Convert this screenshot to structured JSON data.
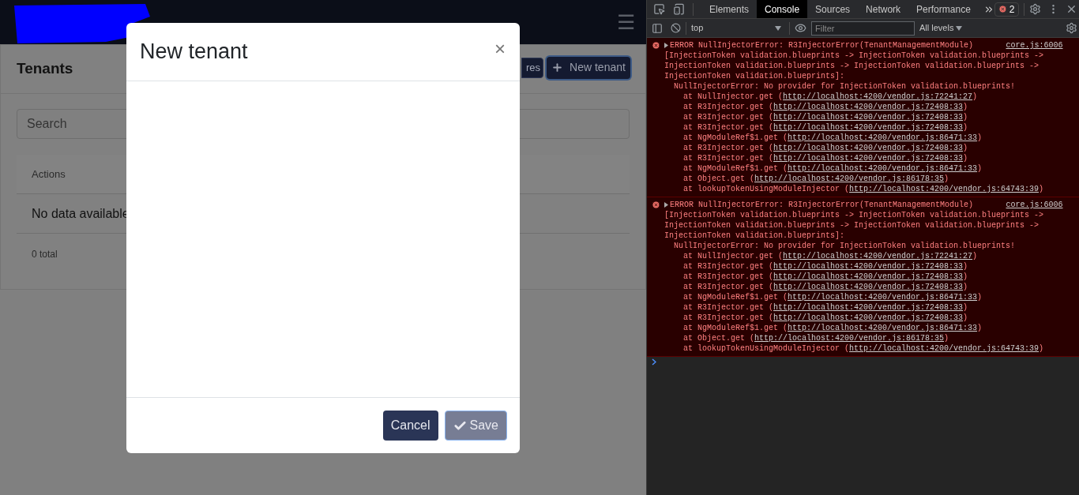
{
  "app": {
    "menu_button": "☰",
    "page_title": "Tenants",
    "header_buttons": [
      {
        "kind": "partial",
        "label": "res"
      },
      {
        "kind": "primary",
        "label": "New tenant",
        "focused": true
      }
    ],
    "search": {
      "placeholder": "Search"
    },
    "table": {
      "columns": [
        "Actions"
      ],
      "empty_text": "No data available",
      "total": "0 total"
    }
  },
  "modal": {
    "title": "New tenant",
    "close": "×",
    "buttons": [
      {
        "kind": "cancel",
        "label": "Cancel",
        "disabled": false
      },
      {
        "kind": "save",
        "label": "Save",
        "disabled": true
      }
    ]
  },
  "devtools": {
    "tabs": [
      {
        "label": "Elements",
        "selected": false
      },
      {
        "label": "Console",
        "selected": true
      },
      {
        "label": "Sources",
        "selected": false
      },
      {
        "label": "Network",
        "selected": false
      },
      {
        "label": "Performance",
        "selected": false
      }
    ],
    "error_count": "2",
    "context": "top",
    "filter": {
      "placeholder": "Filter"
    },
    "levels": "All levels",
    "messages": [
      {
        "source": "core.js:6006",
        "header": "ERROR NullInjectorError: R3InjectorError(TenantManagementModule)",
        "lines": [
          "[InjectionToken validation.blueprints -> InjectionToken validation.blueprints ->",
          "InjectionToken validation.blueprints -> InjectionToken validation.blueprints ->",
          "InjectionToken validation.blueprints]:"
        ],
        "detail": "NullInjectorError: No provider for InjectionToken validation.blueprints!",
        "stack": [
          {
            "text": "at NullInjector.get (",
            "link": "http://localhost:4200/vendor.js:72241:27",
            "end": ")"
          },
          {
            "text": "at R3Injector.get (",
            "link": "http://localhost:4200/vendor.js:72408:33",
            "end": ")"
          },
          {
            "text": "at R3Injector.get (",
            "link": "http://localhost:4200/vendor.js:72408:33",
            "end": ")"
          },
          {
            "text": "at R3Injector.get (",
            "link": "http://localhost:4200/vendor.js:72408:33",
            "end": ")"
          },
          {
            "text": "at NgModuleRef$1.get (",
            "link": "http://localhost:4200/vendor.js:86471:33",
            "end": ")"
          },
          {
            "text": "at R3Injector.get (",
            "link": "http://localhost:4200/vendor.js:72408:33",
            "end": ")"
          },
          {
            "text": "at R3Injector.get (",
            "link": "http://localhost:4200/vendor.js:72408:33",
            "end": ")"
          },
          {
            "text": "at NgModuleRef$1.get (",
            "link": "http://localhost:4200/vendor.js:86471:33",
            "end": ")"
          },
          {
            "text": "at Object.get (",
            "link": "http://localhost:4200/vendor.js:86178:35",
            "end": ")"
          },
          {
            "text": "at lookupTokenUsingModuleInjector (",
            "link": "http://localhost:4200/vendor.js:64743:39",
            "end": ")"
          }
        ]
      },
      {
        "source": "core.js:6006",
        "header": "ERROR NullInjectorError: R3InjectorError(TenantManagementModule)",
        "lines": [
          "[InjectionToken validation.blueprints -> InjectionToken validation.blueprints ->",
          "InjectionToken validation.blueprints -> InjectionToken validation.blueprints ->",
          "InjectionToken validation.blueprints]:"
        ],
        "detail": "NullInjectorError: No provider for InjectionToken validation.blueprints!",
        "stack": [
          {
            "text": "at NullInjector.get (",
            "link": "http://localhost:4200/vendor.js:72241:27",
            "end": ")"
          },
          {
            "text": "at R3Injector.get (",
            "link": "http://localhost:4200/vendor.js:72408:33",
            "end": ")"
          },
          {
            "text": "at R3Injector.get (",
            "link": "http://localhost:4200/vendor.js:72408:33",
            "end": ")"
          },
          {
            "text": "at R3Injector.get (",
            "link": "http://localhost:4200/vendor.js:72408:33",
            "end": ")"
          },
          {
            "text": "at NgModuleRef$1.get (",
            "link": "http://localhost:4200/vendor.js:86471:33",
            "end": ")"
          },
          {
            "text": "at R3Injector.get (",
            "link": "http://localhost:4200/vendor.js:72408:33",
            "end": ")"
          },
          {
            "text": "at R3Injector.get (",
            "link": "http://localhost:4200/vendor.js:72408:33",
            "end": ")"
          },
          {
            "text": "at NgModuleRef$1.get (",
            "link": "http://localhost:4200/vendor.js:86471:33",
            "end": ")"
          },
          {
            "text": "at Object.get (",
            "link": "http://localhost:4200/vendor.js:86178:35",
            "end": ")"
          },
          {
            "text": "at lookupTokenUsingModuleInjector (",
            "link": "http://localhost:4200/vendor.js:64743:39",
            "end": ")"
          }
        ]
      }
    ]
  }
}
